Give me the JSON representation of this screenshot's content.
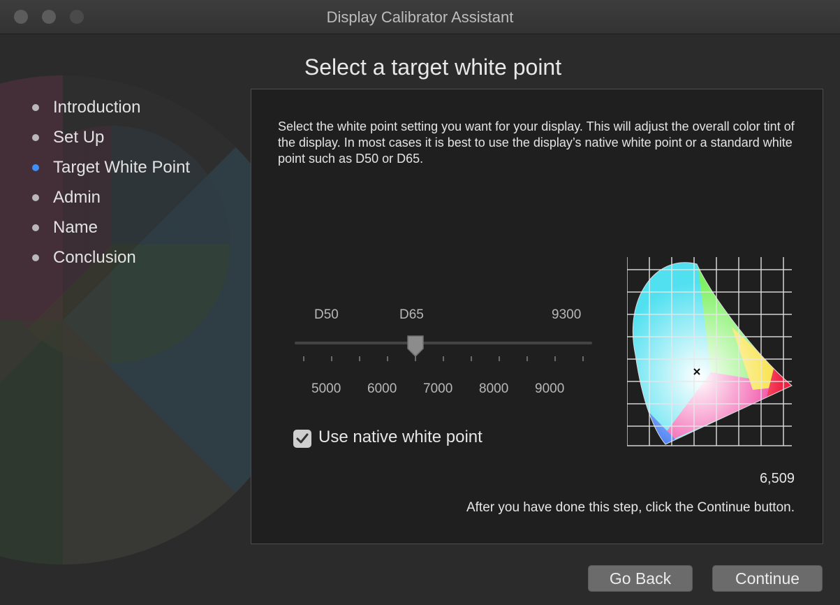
{
  "window": {
    "title": "Display Calibrator Assistant"
  },
  "page": {
    "title": "Select a target white point"
  },
  "steps": [
    {
      "label": "Introduction",
      "active": false
    },
    {
      "label": "Set Up",
      "active": false
    },
    {
      "label": "Target White Point",
      "active": true
    },
    {
      "label": "Admin",
      "active": false
    },
    {
      "label": "Name",
      "active": false
    },
    {
      "label": "Conclusion",
      "active": false
    }
  ],
  "panel": {
    "description": "Select the white point setting you want for your display.  This will adjust the overall color tint of the display.  In most cases it is best to use the display’s native white point or a standard white point such as D50 or D65.",
    "slider": {
      "top_labels": [
        "D50",
        "D65",
        "9300"
      ],
      "bottom_labels": [
        "5000",
        "6000",
        "7000",
        "8000",
        "9000"
      ],
      "value": 6509
    },
    "native_checkbox": {
      "label": "Use native white point",
      "checked": true
    },
    "kelvin_readout": "6,509",
    "hint": "After you have done this step, click the Continue button."
  },
  "buttons": {
    "back": "Go Back",
    "continue": "Continue"
  },
  "colors": {
    "accent": "#3e8ef7",
    "background": "#2b2b2b",
    "panel": "#1f1f1f"
  }
}
